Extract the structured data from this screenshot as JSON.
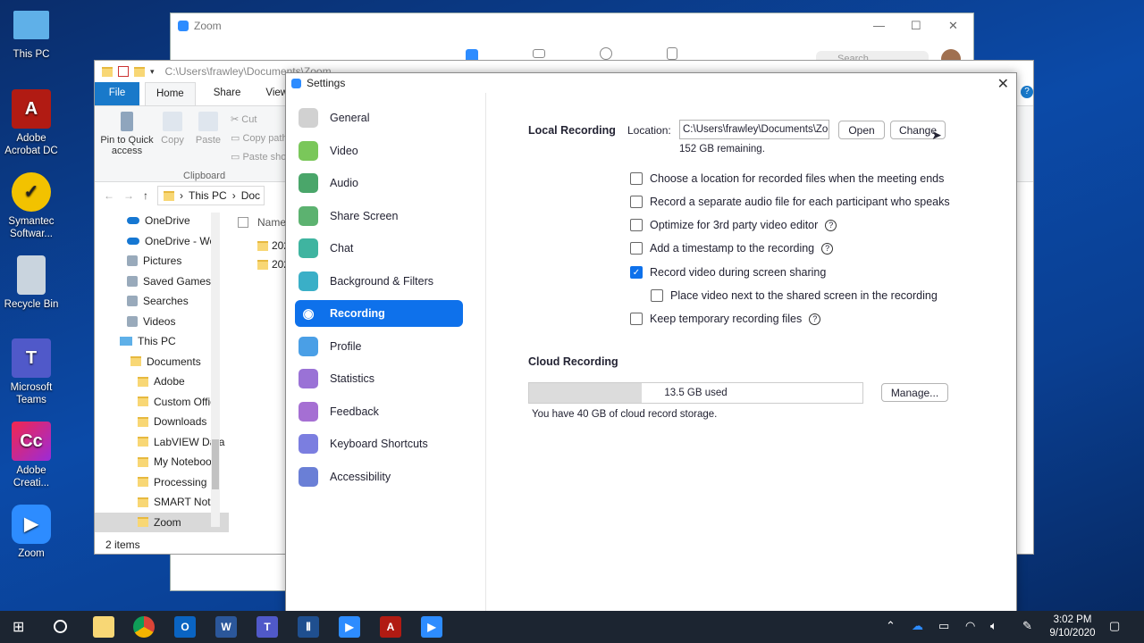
{
  "desktop": {
    "icons": [
      {
        "label": "This PC"
      },
      {
        "label": "Adobe Acrobat DC"
      },
      {
        "label": "Symantec Softwar..."
      },
      {
        "label": "Recycle Bin"
      },
      {
        "label": "Microsoft Teams"
      },
      {
        "label": "Adobe Creati..."
      },
      {
        "label": "Zoom"
      }
    ]
  },
  "zoom_main": {
    "title": "Zoom",
    "search_placeholder": "Search"
  },
  "explorer": {
    "path": "C:\\Users\\frawley\\Documents\\Zoom",
    "tabs": {
      "file": "File",
      "home": "Home",
      "share": "Share",
      "view": "View"
    },
    "ribbon": {
      "pin": "Pin to Quick access",
      "copy": "Copy",
      "paste": "Paste",
      "cut": "Cut",
      "copy_path": "Copy path",
      "paste_shortcut": "Paste sho",
      "group_clipboard": "Clipboard"
    },
    "address": {
      "this_pc": "This PC",
      "doc": "Doc"
    },
    "column_name": "Name",
    "files": [
      "202",
      "202"
    ],
    "tree": [
      "OneDrive",
      "OneDrive - Wo",
      "Pictures",
      "Saved Games",
      "Searches",
      "Videos",
      "This PC",
      "Documents",
      "Adobe",
      "Custom Offic",
      "Downloads",
      "LabVIEW Data",
      "My Notebook",
      "Processing",
      "SMART Notel",
      "Zoom"
    ],
    "status": "2 items"
  },
  "settings": {
    "title": "Settings",
    "nav": [
      {
        "label": "General",
        "color": "#d1d1d1"
      },
      {
        "label": "Video",
        "color": "#7ac75a"
      },
      {
        "label": "Audio",
        "color": "#4aa66a"
      },
      {
        "label": "Share Screen",
        "color": "#5cb270"
      },
      {
        "label": "Chat",
        "color": "#3fb4a0"
      },
      {
        "label": "Background & Filters",
        "color": "#3aafc7"
      },
      {
        "label": "Recording",
        "color": "#0e71eb"
      },
      {
        "label": "Profile",
        "color": "#4a9fe6"
      },
      {
        "label": "Statistics",
        "color": "#9a72d6"
      },
      {
        "label": "Feedback",
        "color": "#a56fd3"
      },
      {
        "label": "Keyboard Shortcuts",
        "color": "#7b7ee0"
      },
      {
        "label": "Accessibility",
        "color": "#6a7fd6"
      }
    ],
    "local": {
      "heading": "Local Recording",
      "location_label": "Location:",
      "location_value": "C:\\Users\\frawley\\Documents\\Zoom",
      "open": "Open",
      "change": "Change",
      "remaining": "152 GB remaining."
    },
    "options": [
      {
        "label": "Choose a location for recorded files when the meeting ends",
        "checked": false,
        "help": false
      },
      {
        "label": "Record a separate audio file for each participant who speaks",
        "checked": false,
        "help": false
      },
      {
        "label": "Optimize for 3rd party video editor",
        "checked": false,
        "help": true
      },
      {
        "label": "Add a timestamp to the recording",
        "checked": false,
        "help": true
      },
      {
        "label": "Record video during screen sharing",
        "checked": true,
        "help": false
      },
      {
        "label": "Place video next to the shared screen in the recording",
        "checked": false,
        "help": false
      },
      {
        "label": "Keep temporary recording files",
        "checked": false,
        "help": true
      }
    ],
    "cloud": {
      "heading": "Cloud Recording",
      "used": "13.5 GB used",
      "used_fraction": 0.3375,
      "manage": "Manage...",
      "storage_note": "You have 40 GB of cloud record storage."
    }
  },
  "taskbar": {
    "time": "3:02 PM",
    "date": "9/10/2020"
  }
}
